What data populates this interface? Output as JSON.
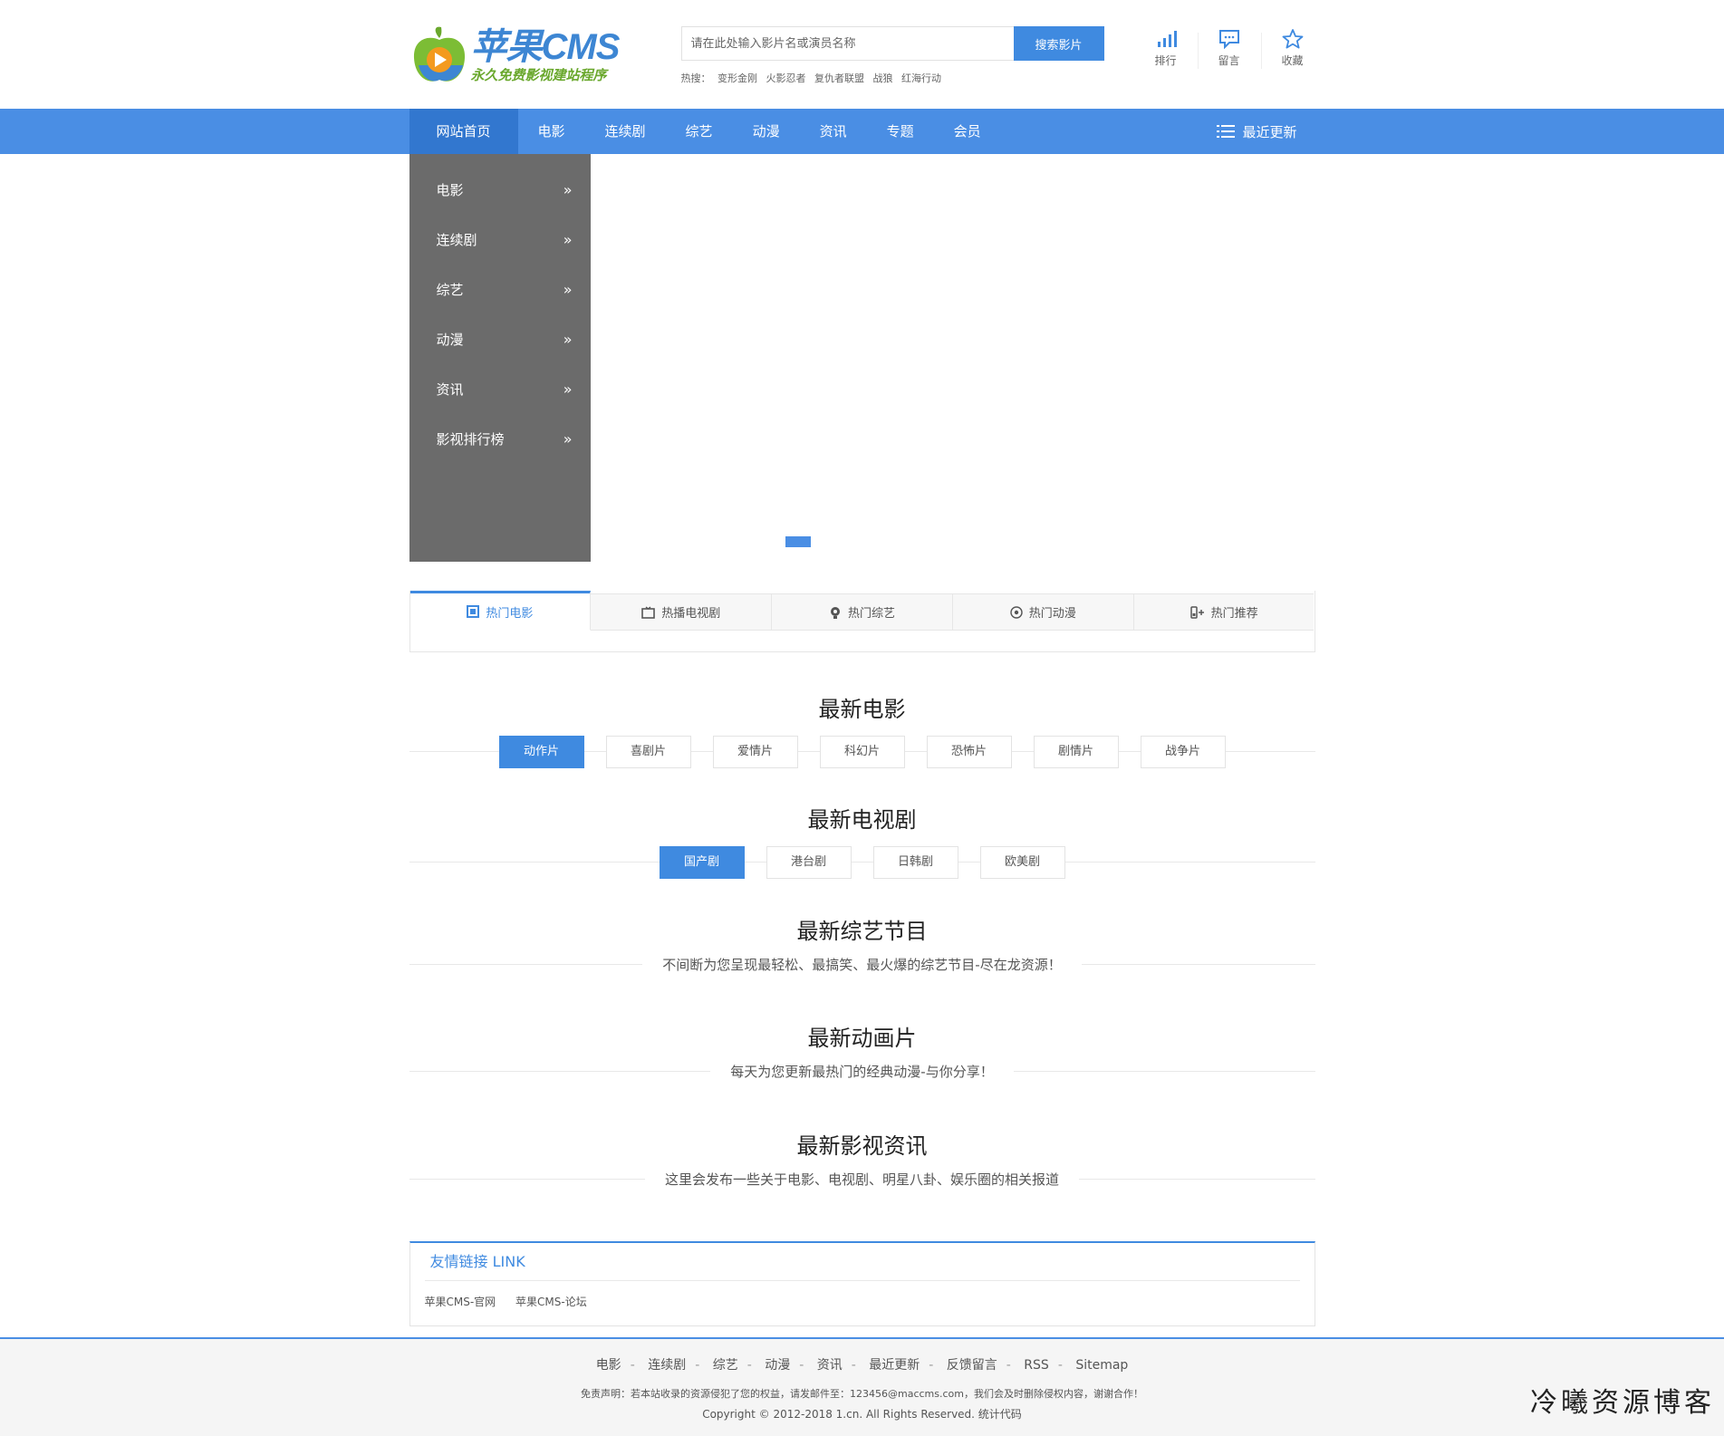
{
  "brand": {
    "title": "苹果CMS",
    "subtitle": "永久免费影视建站程序"
  },
  "search": {
    "placeholder": "请在此处输入影片名或演员名称",
    "button": "搜索影片",
    "hot_label": "热搜：",
    "hot_terms": [
      "变形金刚",
      "火影忍者",
      "复仇者联盟",
      "战狼",
      "红海行动"
    ]
  },
  "tools": [
    {
      "label": "排行",
      "icon": "ranking-icon"
    },
    {
      "label": "留言",
      "icon": "message-icon"
    },
    {
      "label": "收藏",
      "icon": "star-icon"
    }
  ],
  "nav": {
    "items": [
      "网站首页",
      "电影",
      "连续剧",
      "综艺",
      "动漫",
      "资讯",
      "专题",
      "会员"
    ],
    "recent": "最近更新"
  },
  "side_menu": [
    "电影",
    "连续剧",
    "综艺",
    "动漫",
    "资讯",
    "影视排行榜"
  ],
  "side_arrow": "»",
  "tabs": [
    {
      "label": "热门电影",
      "icon": "film-icon"
    },
    {
      "label": "热播电视剧",
      "icon": "tv-icon"
    },
    {
      "label": "热门综艺",
      "icon": "variety-icon"
    },
    {
      "label": "热门动漫",
      "icon": "anime-icon"
    },
    {
      "label": "热门推荐",
      "icon": "recommend-icon"
    }
  ],
  "sections": {
    "movies": {
      "title": "最新电影",
      "cats": [
        "动作片",
        "喜剧片",
        "爱情片",
        "科幻片",
        "恐怖片",
        "剧情片",
        "战争片"
      ]
    },
    "tv": {
      "title": "最新电视剧",
      "cats": [
        "国产剧",
        "港台剧",
        "日韩剧",
        "欧美剧"
      ]
    },
    "variety": {
      "title": "最新综艺节目",
      "desc": "不间断为您呈现最轻松、最搞笑、最火爆的综艺节目-尽在龙资源！"
    },
    "anime": {
      "title": "最新动画片",
      "desc": "每天为您更新最热门的经典动漫-与你分享！"
    },
    "news": {
      "title": "最新影视资讯",
      "desc": "这里会发布一些关于电影、电视剧、明星八卦、娱乐圈的相关报道"
    }
  },
  "links": {
    "title": "友情链接 LINK",
    "items": [
      "苹果CMS-官网",
      "苹果CMS-论坛"
    ]
  },
  "footer": {
    "nav": [
      "电影",
      "连续剧",
      "综艺",
      "动漫",
      "资讯",
      "最近更新",
      "反馈留言",
      "RSS",
      "Sitemap"
    ],
    "sep": "-",
    "disclaimer": "免责声明：若本站收录的资源侵犯了您的权益，请发邮件至：123456@maccms.com，我们会及时删除侵权内容，谢谢合作！",
    "copyright": "Copyright © 2012-2018 1.cn. All Rights Reserved. 统计代码"
  },
  "watermark": "冷曦资源博客",
  "colors": {
    "accent": "#4a8ee4",
    "sidebar": "#6b6b6b"
  }
}
